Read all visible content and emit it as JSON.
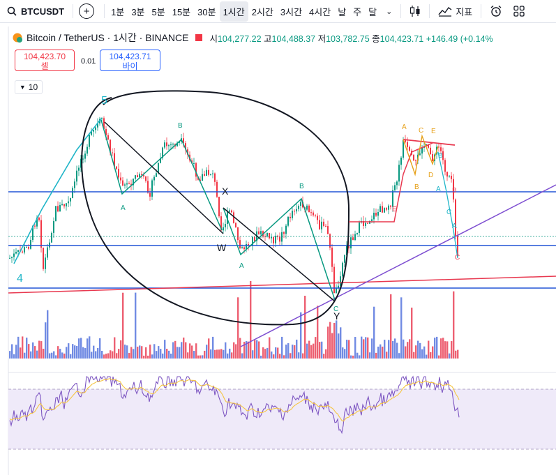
{
  "toolbar": {
    "symbol": "BTCUSDT",
    "add": "+",
    "timeframes": [
      "1분",
      "3분",
      "5분",
      "15분",
      "30분",
      "1시간",
      "2시간",
      "3시간",
      "4시간",
      "날",
      "주",
      "달"
    ],
    "active_timeframe": "1시간",
    "indicators": "지표"
  },
  "legend": {
    "title": "Bitcoin / TetherUS · 1시간 · BINANCE",
    "open_label": "시",
    "open": "104,277.22",
    "high_label": "고",
    "high": "104,488.37",
    "low_label": "저",
    "low": "103,782.75",
    "close_label": "종",
    "close": "104,423.71",
    "change": "+146.49 (+0.14%"
  },
  "trade": {
    "sell_price": "104,423.70",
    "sell_label": "셀",
    "spread": "0.01",
    "buy_price": "104,423.71",
    "buy_label": "바이"
  },
  "collapse": {
    "count": "10"
  },
  "annotations": {
    "wave_4": "4",
    "wave_5": "5",
    "x": "X",
    "w": "W",
    "y": "Y",
    "a": "A",
    "b": "B",
    "c": "C",
    "d": "D",
    "e": "E"
  },
  "colors": {
    "up": "#089981",
    "down": "#f23645",
    "h_line": "#2255d6",
    "trend_red": "#e8384f",
    "trend_purple": "#7e4fd1",
    "cyan": "#20b5c8",
    "rsi": "#7e57c2",
    "rsi_ma": "#f5c542",
    "abcde": "#e6a11a"
  }
}
